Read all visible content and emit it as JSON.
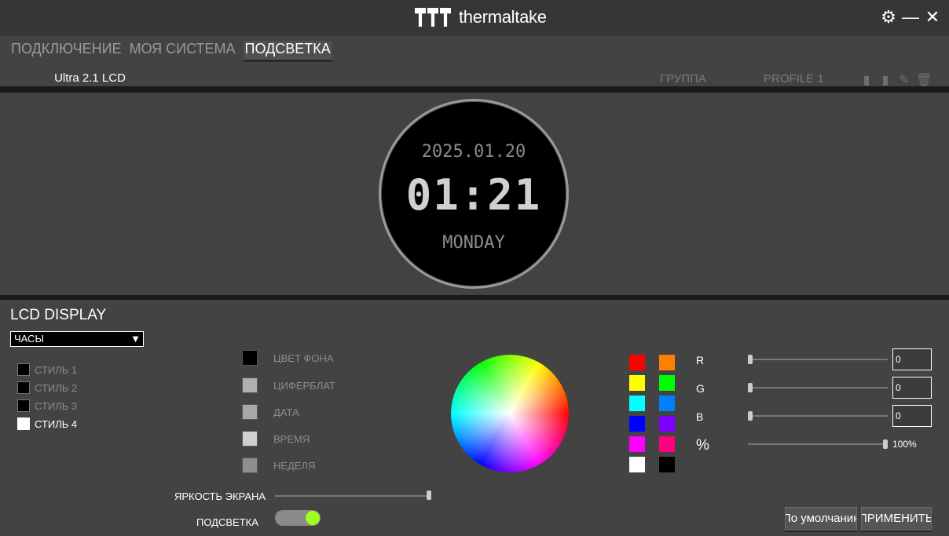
{
  "titlebar": {
    "brand": "thermaltake",
    "settings_icon": "gear-icon",
    "minimize_icon": "minimize-icon",
    "close_icon": "close-icon"
  },
  "main_tabs": [
    {
      "label": "ПОДКЛЮЧЕНИЕ",
      "active": false
    },
    {
      "label": "МОЯ СИСТЕМА",
      "active": false
    },
    {
      "label": "ПОДСВЕТКА",
      "active": true
    }
  ],
  "subbar": {
    "device_tab": "Ultra 2.1 LCD",
    "group_label": "ГРУППА",
    "profile_label": "PROFILE 1",
    "tools": [
      "save-icon",
      "copy-icon",
      "pencil-icon",
      "trash-icon"
    ]
  },
  "lcd_preview": {
    "date": "2025.01.20",
    "time": "01:21",
    "day": "MONDAY"
  },
  "lcd_display": {
    "title": "LCD DISPLAY",
    "mode_selected": "ЧАСЫ",
    "styles": [
      {
        "label": "СТИЛЬ 1",
        "selected": false
      },
      {
        "label": "СТИЛЬ 2",
        "selected": false
      },
      {
        "label": "СТИЛЬ 3",
        "selected": false
      },
      {
        "label": "СТИЛЬ 4",
        "selected": true
      }
    ],
    "color_targets": [
      {
        "label": "ЦВЕТ ФОНА",
        "color": "#000000"
      },
      {
        "label": "ЦИФЕРБЛАТ",
        "color": "#b0b0b0"
      },
      {
        "label": "ДАТА",
        "color": "#a8a8a8"
      },
      {
        "label": "ВРЕМЯ",
        "color": "#d0d0d0"
      },
      {
        "label": "НЕДЕЛЯ",
        "color": "#8e8e8e"
      }
    ],
    "palette": [
      "#ff0000",
      "#ff8000",
      "#ffff00",
      "#00ff00",
      "#00ffff",
      "#0080ff",
      "#0000ff",
      "#8000ff",
      "#ff00ff",
      "#ff0080",
      "#ffffff",
      "#000000"
    ],
    "rgb": {
      "r_label": "R",
      "r_value": "0",
      "g_label": "G",
      "g_value": "0",
      "b_label": "B",
      "b_value": "0",
      "pct_label": "%",
      "pct_value": "100%"
    },
    "brightness_label": "ЯРКОСТЬ ЭКРАНА",
    "brightness_value": 1.0,
    "lighting_label": "ПОДСВЕТКА",
    "lighting_on": true
  },
  "buttons": {
    "default_label": "По умолчанию",
    "apply_label": "ПРИМЕНИТЬ"
  }
}
